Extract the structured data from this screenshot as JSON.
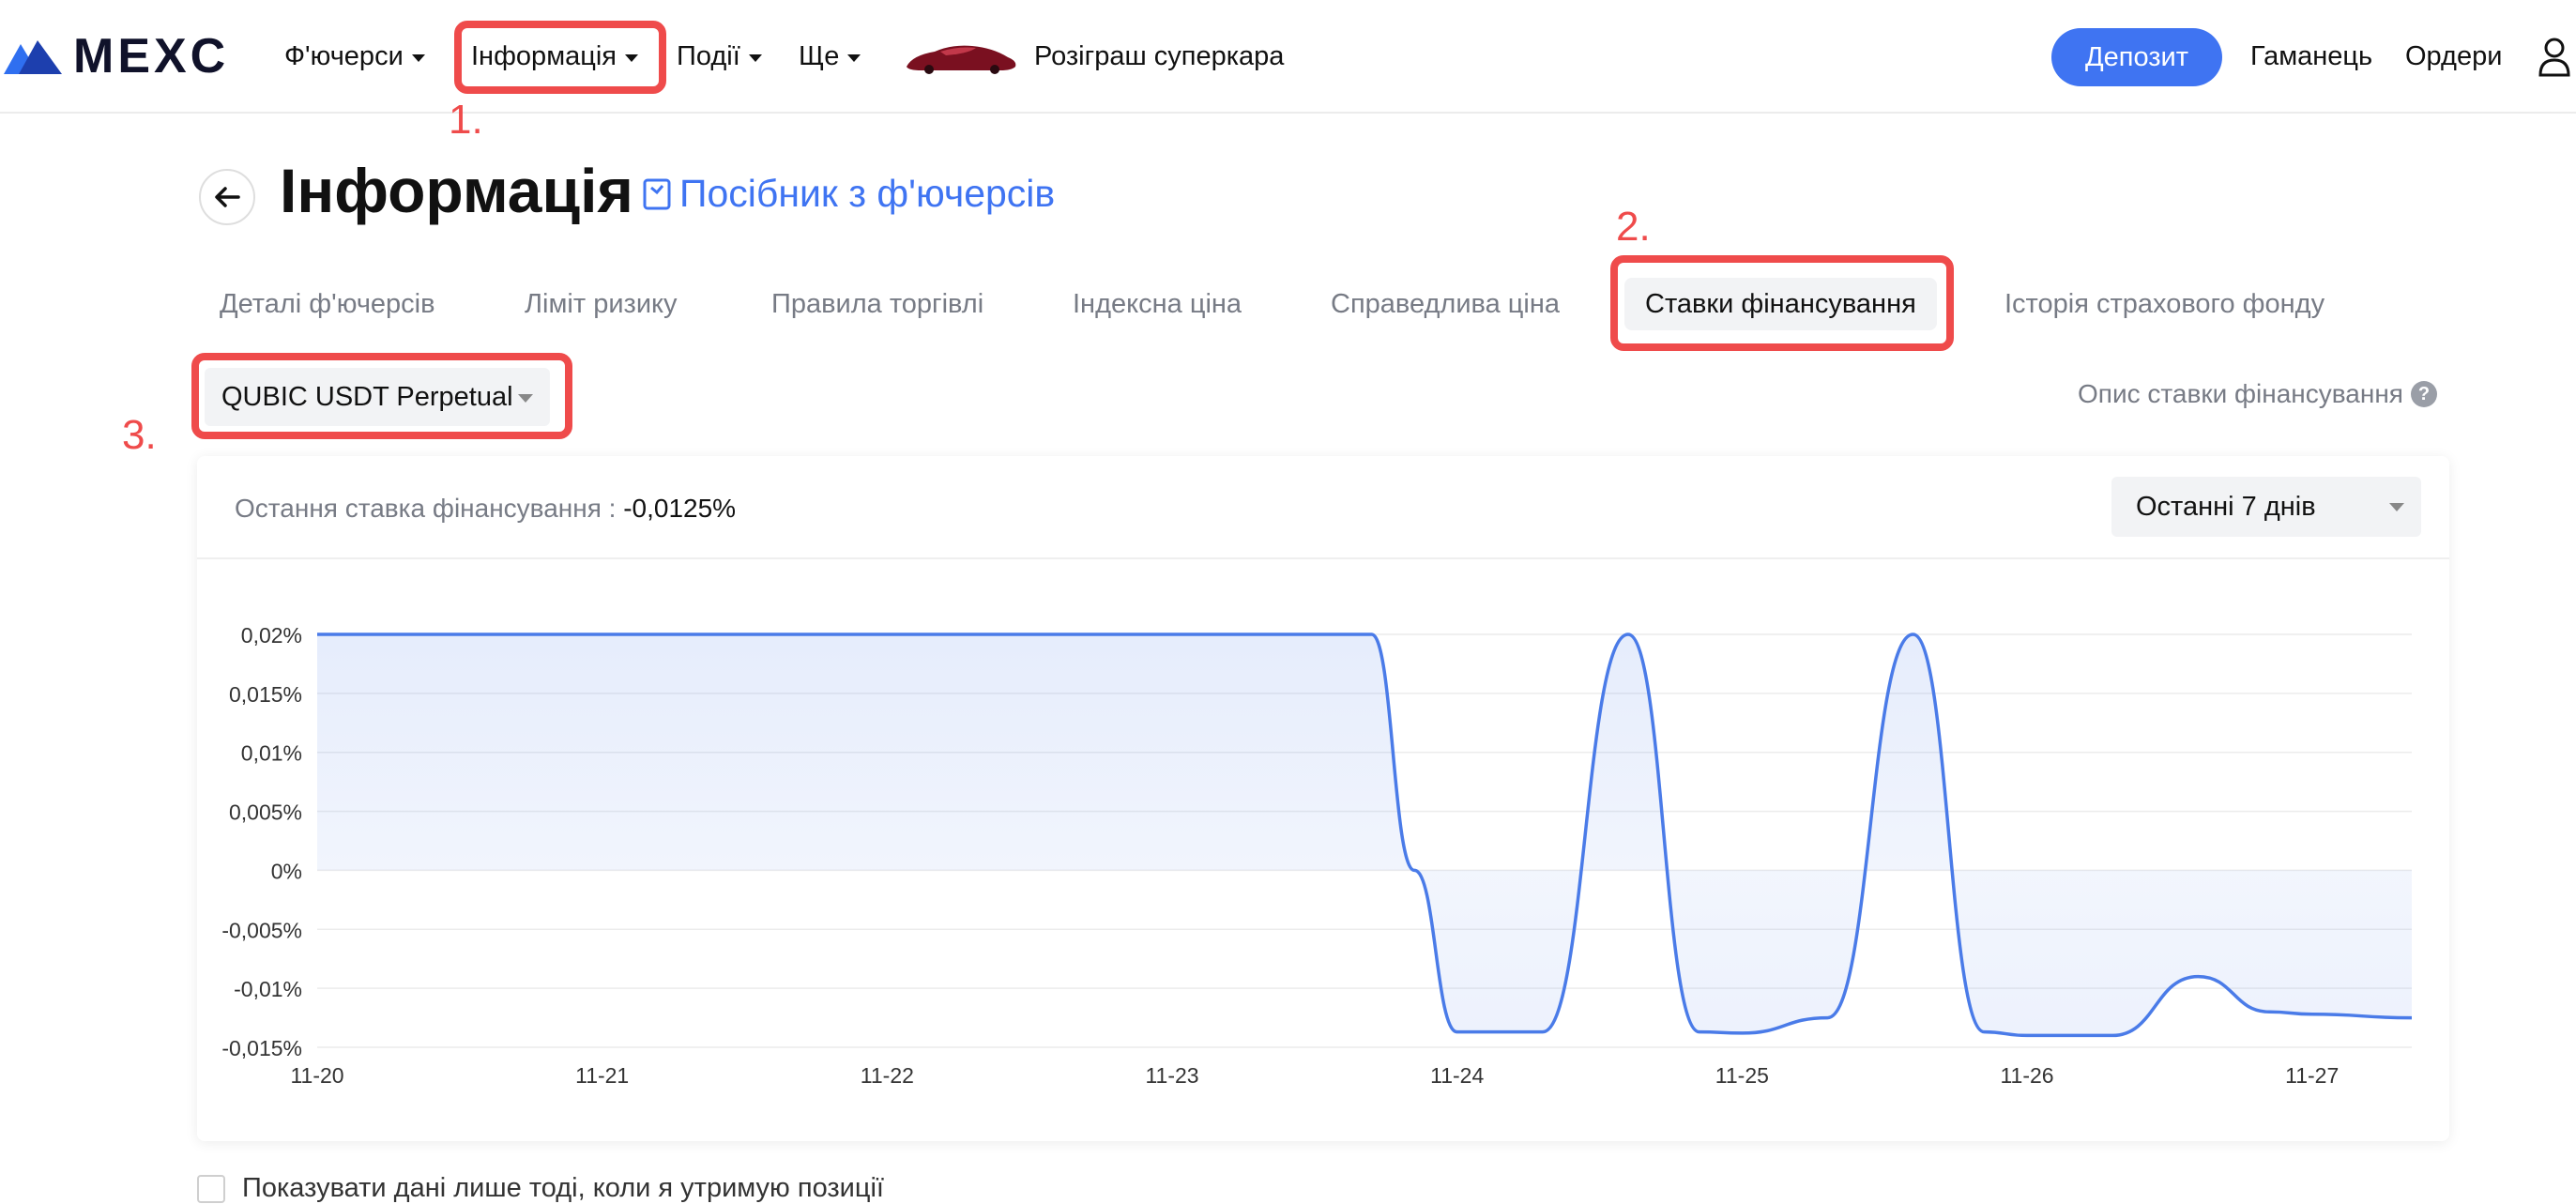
{
  "brand": {
    "name": "MEXC",
    "color": "#10122a",
    "icon": "mexc-logo-icon"
  },
  "nav": {
    "items": [
      {
        "label": "Ф'ючерси",
        "has_dropdown": true
      },
      {
        "label": "Інформація",
        "has_dropdown": true
      },
      {
        "label": "Події",
        "has_dropdown": true
      },
      {
        "label": "Ще",
        "has_dropdown": true
      },
      {
        "label": "Розіграш суперкара",
        "icon": "car-icon"
      }
    ],
    "deposit_label": "Депозит",
    "wallet_label": "Гаманець",
    "orders_label": "Ордери",
    "user_icon": "user-icon"
  },
  "annotations": [
    "1.",
    "2.",
    "3."
  ],
  "page": {
    "title": "Інформація",
    "guide_link": "Посібник з ф'ючерсів"
  },
  "tabs": [
    {
      "label": "Деталі ф'ючерсів",
      "active": false
    },
    {
      "label": "Ліміт ризику",
      "active": false
    },
    {
      "label": "Правила торгівлі",
      "active": false
    },
    {
      "label": "Індексна ціна",
      "active": false
    },
    {
      "label": "Справедлива ціна",
      "active": false
    },
    {
      "label": "Ставки фінансування",
      "active": true
    },
    {
      "label": "Історія страхового фонду",
      "active": false
    }
  ],
  "symbol_select": {
    "value": "QUBIC USDT Perpetual"
  },
  "rate_description_link": "Опис ставки фінансування",
  "card": {
    "last_rate_label": "Остання ставка фінансування :",
    "last_rate_value": "-0,0125%",
    "period_select": "Останні 7 днів"
  },
  "only_positions_label": "Показувати дані лише тоді, коли я утримую позиції",
  "colors": {
    "accent": "#3f74f2",
    "annotation": "#ef4b4b",
    "line": "#4a7be8"
  },
  "chart_data": {
    "type": "area",
    "title": "",
    "xlabel": "",
    "ylabel": "",
    "x_ticks": [
      "11-20",
      "11-21",
      "11-22",
      "11-23",
      "11-24",
      "11-25",
      "11-26",
      "11-27"
    ],
    "y_ticks": [
      "0,02%",
      "0,015%",
      "0,01%",
      "0,005%",
      "0%",
      "-0,005%",
      "-0,01%",
      "-0,015%"
    ],
    "ylim": [
      -0.015,
      0.02
    ],
    "xlim": [
      0,
      7.35
    ],
    "grid": true,
    "series": [
      {
        "name": "",
        "unit": "%",
        "x": [
          0,
          3.7,
          3.85,
          4.0,
          4.3,
          4.6,
          4.85,
          5.0,
          5.3,
          5.6,
          5.85,
          6.0,
          6.3,
          6.6,
          6.85,
          7.0,
          7.35
        ],
        "y": [
          0.02,
          0.02,
          0.0,
          -0.0137,
          -0.0137,
          0.02,
          -0.0137,
          -0.0138,
          -0.0125,
          0.02,
          -0.0137,
          -0.014,
          -0.014,
          -0.009,
          -0.012,
          -0.0122,
          -0.0125
        ]
      }
    ]
  }
}
